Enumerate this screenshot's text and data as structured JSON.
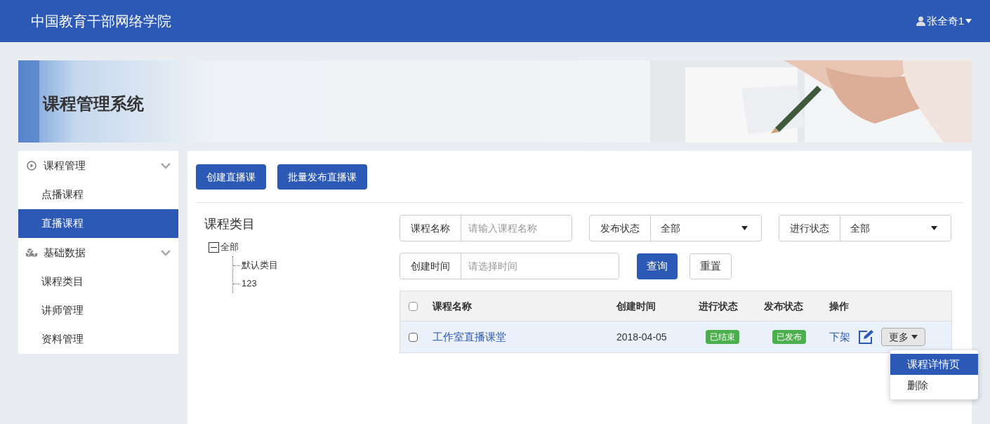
{
  "header": {
    "title": "中国教育干部网络学院",
    "user": "张全奇1"
  },
  "banner": {
    "title": "课程管理系统"
  },
  "sidebar": {
    "groups": [
      {
        "label": "课程管理",
        "kind": "playback",
        "expanded": true,
        "items": [
          {
            "label": "点播课程",
            "selected": false
          },
          {
            "label": "直播课程",
            "selected": true
          }
        ]
      },
      {
        "label": "基础数据",
        "kind": "data",
        "expanded": true,
        "items": [
          {
            "label": "课程类目",
            "selected": false
          },
          {
            "label": "讲师管理",
            "selected": false
          },
          {
            "label": "资料管理",
            "selected": false
          }
        ]
      }
    ]
  },
  "toolbar": {
    "buttons": [
      "创建直播课",
      "批量发布直播课"
    ]
  },
  "category_tree": {
    "title": "课程类目",
    "nodes": [
      {
        "label": "全部",
        "expanded": true,
        "children": [
          {
            "label": "默认类目"
          },
          {
            "label": "123"
          }
        ]
      }
    ]
  },
  "filters": [
    {
      "kind": "text",
      "label": "课程名称",
      "placeholder": "请输入课程名称"
    },
    {
      "kind": "select",
      "label": "发布状态",
      "value": "全部"
    },
    {
      "kind": "select",
      "label": "进行状态",
      "value": "全部"
    },
    {
      "kind": "text",
      "label": "创建时间",
      "placeholder": "请选择时间"
    }
  ],
  "filter_buttons": [
    {
      "label": "查询",
      "kind": "primary"
    },
    {
      "label": "重置",
      "kind": "default"
    }
  ],
  "table": {
    "columns": [
      "课程名称",
      "创建时间",
      "进行状态",
      "发布状态",
      "操作"
    ],
    "header_checked": false,
    "rows": [
      {
        "checked": false,
        "name": "工作室直播课堂",
        "created": "2018-04-05",
        "progress": "已结束",
        "publish": "已发布",
        "action_link": "下架",
        "more": "更多"
      }
    ]
  },
  "more_menu": {
    "items": [
      {
        "label": "课程详情页",
        "selected": true
      },
      {
        "label": "删除",
        "selected": false
      }
    ]
  }
}
